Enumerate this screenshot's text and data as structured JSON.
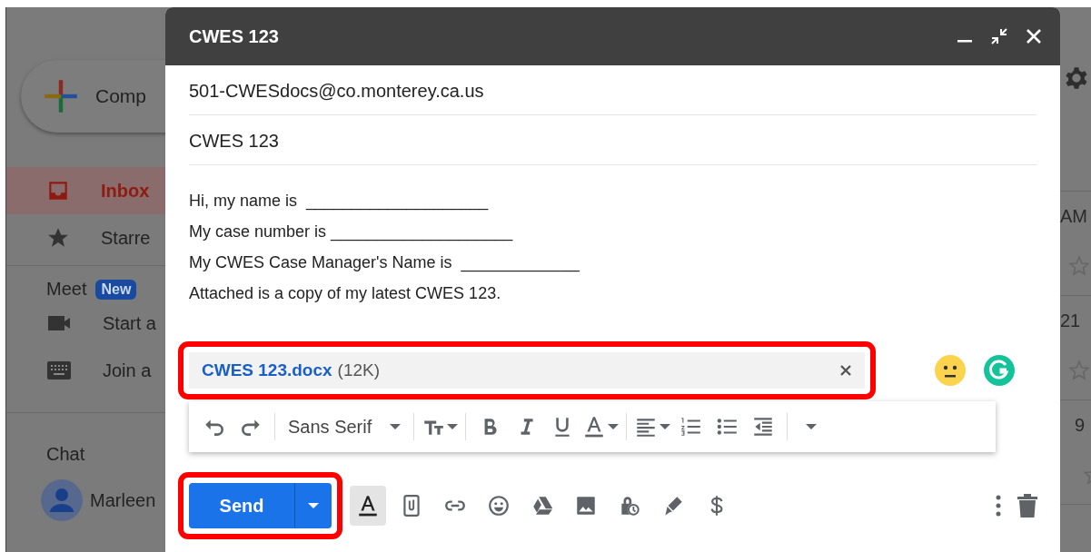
{
  "sidebar": {
    "compose_label": "Comp",
    "items": [
      {
        "label": "Inbox",
        "kind": "inbox",
        "selected": true
      },
      {
        "label": "Starre",
        "kind": "star",
        "selected": false
      }
    ],
    "meet": {
      "title": "Meet",
      "badge": "New",
      "items": [
        {
          "label": "Start a",
          "kind": "video"
        },
        {
          "label": "Join a",
          "kind": "keyboard"
        }
      ]
    },
    "chat": {
      "title": "Chat",
      "contact": "Marleen"
    }
  },
  "mail_list": {
    "times": [
      "AM",
      "21",
      "9"
    ]
  },
  "compose": {
    "title": "CWES 123",
    "to": "501-CWESdocs@co.monterey.ca.us",
    "subject": "CWES 123",
    "body": [
      "Hi, my name is  ____________________",
      "My case number is ____________________",
      "My CWES Case Manager's Name is  _____________",
      "Attached is a copy of my latest CWES 123."
    ],
    "attachment": {
      "name": "CWES 123.docx",
      "size": "(12K)",
      "highlighted": true
    },
    "format_toolbar": [
      {
        "kind": "undo"
      },
      {
        "kind": "redo"
      },
      {
        "kind": "font",
        "label": "Sans Serif"
      },
      {
        "kind": "size"
      },
      {
        "kind": "bold"
      },
      {
        "kind": "italic"
      },
      {
        "kind": "underline"
      },
      {
        "kind": "color"
      },
      {
        "kind": "align"
      },
      {
        "kind": "numbered"
      },
      {
        "kind": "bulleted"
      },
      {
        "kind": "indent"
      },
      {
        "kind": "more"
      }
    ],
    "send": {
      "label": "Send",
      "highlighted": true
    },
    "bottom_tools": [
      {
        "kind": "formatting",
        "selected": true
      },
      {
        "kind": "attach",
        "selected": false
      },
      {
        "kind": "link",
        "selected": false
      },
      {
        "kind": "emoji",
        "selected": false
      },
      {
        "kind": "drive",
        "selected": false
      },
      {
        "kind": "photo",
        "selected": false
      },
      {
        "kind": "confidential",
        "selected": false
      },
      {
        "kind": "signature",
        "selected": false
      },
      {
        "kind": "dollar",
        "selected": false
      }
    ]
  }
}
